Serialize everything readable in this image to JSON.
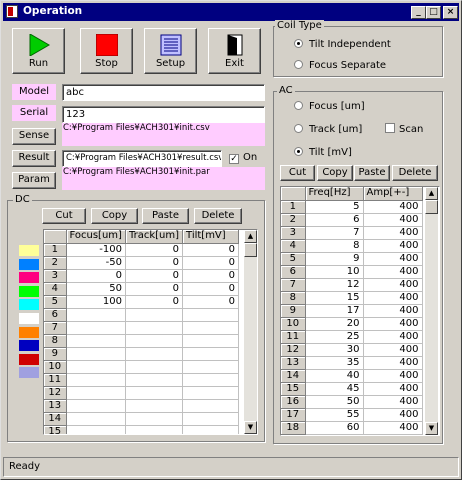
{
  "window": {
    "title": "Operation"
  },
  "toolbar": [
    {
      "label": "Run",
      "icon": "play-icon"
    },
    {
      "label": "Stop",
      "icon": "stop-icon"
    },
    {
      "label": "Setup",
      "icon": "setup-icon"
    },
    {
      "label": "Exit",
      "icon": "exit-door-icon"
    }
  ],
  "fields": {
    "model_label": "Model",
    "model_value": "abc",
    "serial_label": "Serial",
    "serial_value": "123",
    "sense_label": "Sense",
    "sense_path": "C:¥Program Files¥ACH301¥init.csv",
    "result_label": "Result",
    "result_path": "C:¥Program Files¥ACH301¥result.csv",
    "on_label": "On",
    "param_label": "Param",
    "param_path": "C:¥Program Files¥ACH301¥init.par"
  },
  "coil_type": {
    "title": "Coil Type",
    "options": [
      "Tilt Independent",
      "Focus Separate"
    ],
    "selected": 0
  },
  "ac": {
    "title": "AC",
    "options": [
      "Focus [um]",
      "Track [um]",
      "Tilt [mV]"
    ],
    "selected": 2,
    "scan_label": "Scan",
    "buttons": [
      "Cut",
      "Copy",
      "Paste",
      "Delete"
    ],
    "columns": [
      "Freq[Hz]",
      "Amp[+-]"
    ],
    "rows": [
      [
        "1",
        "5",
        "400"
      ],
      [
        "2",
        "6",
        "400"
      ],
      [
        "3",
        "7",
        "400"
      ],
      [
        "4",
        "8",
        "400"
      ],
      [
        "5",
        "9",
        "400"
      ],
      [
        "6",
        "10",
        "400"
      ],
      [
        "7",
        "12",
        "400"
      ],
      [
        "8",
        "15",
        "400"
      ],
      [
        "9",
        "17",
        "400"
      ],
      [
        "10",
        "20",
        "400"
      ],
      [
        "11",
        "25",
        "400"
      ],
      [
        "12",
        "30",
        "400"
      ],
      [
        "13",
        "35",
        "400"
      ],
      [
        "14",
        "40",
        "400"
      ],
      [
        "15",
        "45",
        "400"
      ],
      [
        "16",
        "50",
        "400"
      ],
      [
        "17",
        "55",
        "400"
      ],
      [
        "18",
        "60",
        "400"
      ]
    ]
  },
  "dc": {
    "title": "DC",
    "buttons": [
      "Cut",
      "Copy",
      "Paste",
      "Delete"
    ],
    "columns": [
      "Focus[um]",
      "Track[um]",
      "Tilt[mV]"
    ],
    "rows": [
      [
        "1",
        "-100",
        "0",
        "0"
      ],
      [
        "2",
        "-50",
        "0",
        "0"
      ],
      [
        "3",
        "0",
        "0",
        "0"
      ],
      [
        "4",
        "50",
        "0",
        "0"
      ],
      [
        "5",
        "100",
        "0",
        "0"
      ],
      [
        "6",
        "",
        "",
        ""
      ],
      [
        "7",
        "",
        "",
        ""
      ],
      [
        "8",
        "",
        "",
        ""
      ],
      [
        "9",
        "",
        "",
        ""
      ],
      [
        "10",
        "",
        "",
        ""
      ],
      [
        "11",
        "",
        "",
        ""
      ],
      [
        "12",
        "",
        "",
        ""
      ],
      [
        "13",
        "",
        "",
        ""
      ],
      [
        "14",
        "",
        "",
        ""
      ],
      [
        "15",
        "",
        "",
        ""
      ]
    ],
    "swatch_colors": [
      "#ffff99",
      "#0080ff",
      "#ff0080",
      "#00ff00",
      "#00ffff",
      "#ffffff",
      "#ff8000",
      "#0000c0",
      "#d00000",
      "#a0a0e0"
    ]
  },
  "status": "Ready"
}
